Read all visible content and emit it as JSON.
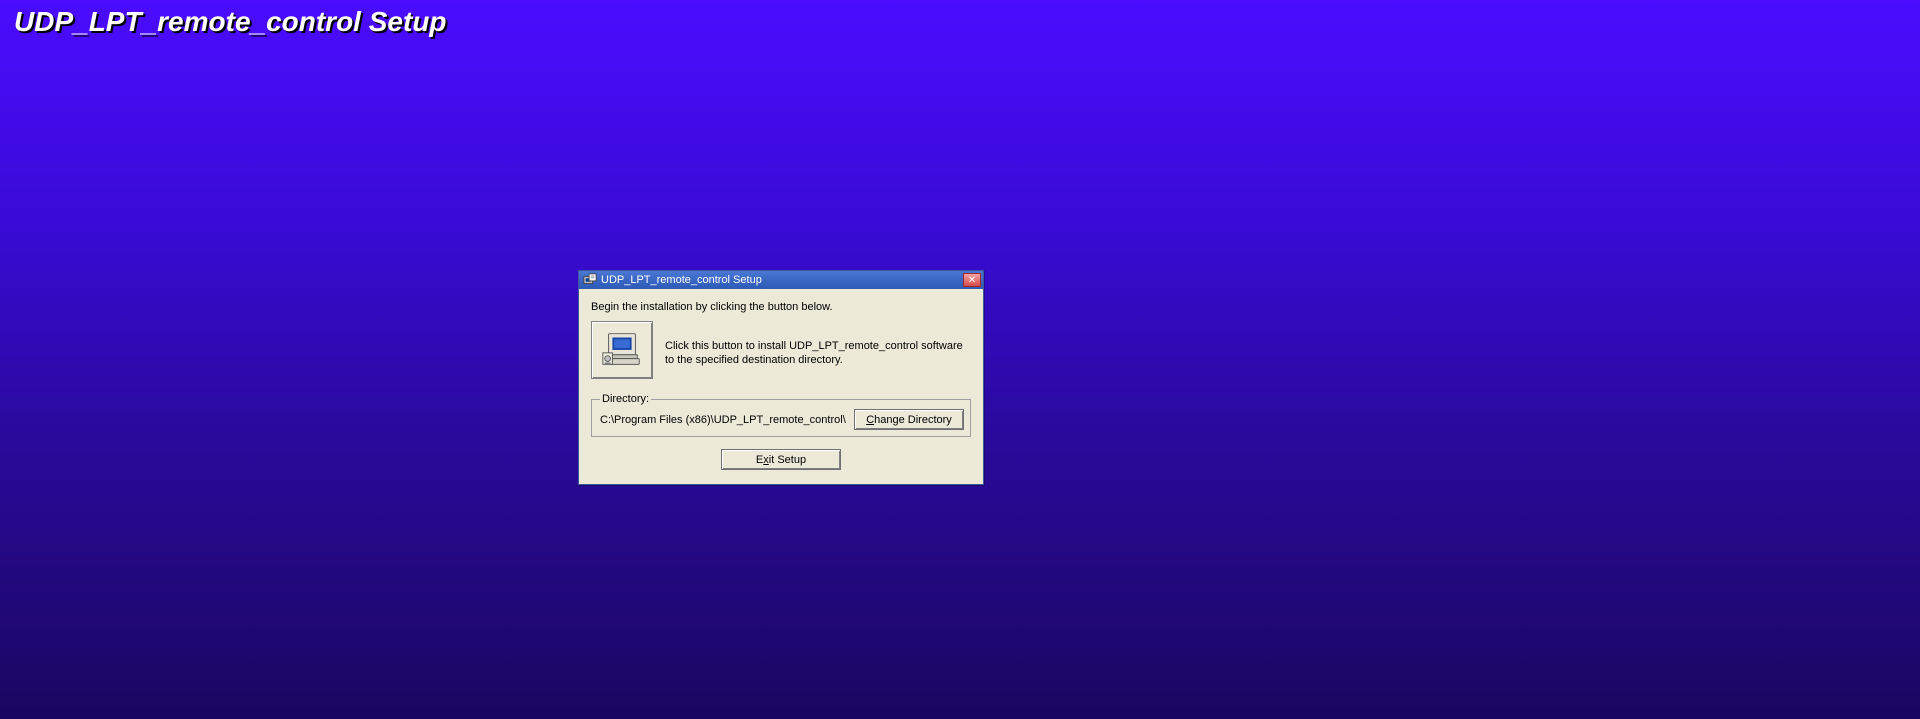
{
  "backdrop": {
    "title": "UDP_LPT_remote_control Setup"
  },
  "dialog": {
    "title": "UDP_LPT_remote_control Setup",
    "instruction": "Begin the installation by clicking the button below.",
    "install_desc": "Click this button to install UDP_LPT_remote_control software to the specified destination directory.",
    "directory_legend": "Directory:",
    "directory_path": "C:\\Program Files (x86)\\UDP_LPT_remote_control\\",
    "change_dir_prefix": "C",
    "change_dir_rest": "hange Directory",
    "exit_prefix": "E",
    "exit_mid": "x",
    "exit_rest": "it Setup"
  }
}
